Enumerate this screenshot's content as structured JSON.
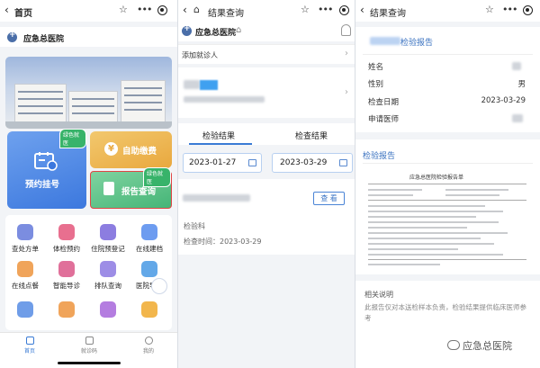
{
  "colors": {
    "accent": "#3a7bd5",
    "green": "#38b36a",
    "orange": "#e9a83e",
    "red_outline": "#e04545"
  },
  "p1": {
    "nav": {
      "back_icon": "chevron-left-icon",
      "title": "首页",
      "star_icon": "star-icon",
      "more_icon": "more-dots-icon",
      "record_icon": "record-icon"
    },
    "hospital_name": "应急总医院",
    "tiles": {
      "appointment": {
        "label": "预约挂号",
        "tag": "绿色就医"
      },
      "payment": {
        "label": "自助缴费"
      },
      "report": {
        "label": "报告查询",
        "tag": "绿色就医"
      }
    },
    "grid": [
      {
        "label": "查处方单",
        "color": "#7b8de0"
      },
      {
        "label": "体检预约",
        "color": "#e86f8f"
      },
      {
        "label": "住院预登记",
        "color": "#8c7de0"
      },
      {
        "label": "在线建档",
        "color": "#6d9cf0"
      },
      {
        "label": "在线点餐",
        "color": "#f0a45a"
      },
      {
        "label": "智能导诊",
        "color": "#e0709a"
      },
      {
        "label": "排队查询",
        "color": "#9d8de6"
      },
      {
        "label": "医院导航",
        "color": "#63a8e8"
      },
      {
        "label": "",
        "color": "#6f9de8"
      },
      {
        "label": "",
        "color": "#f0a45a"
      },
      {
        "label": "",
        "color": "#b47de0"
      },
      {
        "label": "",
        "color": "#f2b64c"
      }
    ],
    "tabbar": [
      {
        "label": "首页"
      },
      {
        "label": "就诊码"
      },
      {
        "label": "我的"
      }
    ]
  },
  "p2": {
    "nav": {
      "title": "结果查询",
      "home_icon": "home-icon"
    },
    "hospital_name": "应急总医院",
    "add_patient": "添加就诊人",
    "tabs": [
      "检验结果",
      "检查结果"
    ],
    "start_date": "2023-01-27",
    "end_date": "2023-03-29",
    "view_button": "查 看",
    "sample": "检验科",
    "check_time": "检查时间：2023-03-29"
  },
  "p3": {
    "nav": {
      "title": "结果查询"
    },
    "report_title": "检验报告",
    "fields": [
      {
        "label": "姓名",
        "value": ""
      },
      {
        "label": "性别",
        "value": "男"
      },
      {
        "label": "检查日期",
        "value": "2023-03-29"
      },
      {
        "label": "申请医师",
        "value": ""
      }
    ],
    "section_report": "检验报告",
    "scan_title": "应急总医院检验报告单",
    "note_title": "相关说明",
    "note_text": "此报告仅对本送检样本负责，检验结果提供临床医师参考",
    "watermark": "应急总医院"
  }
}
